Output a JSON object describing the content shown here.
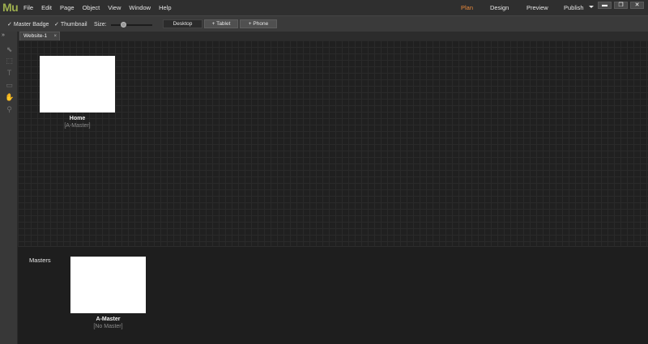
{
  "app": {
    "logo": "Mu"
  },
  "menu": [
    "File",
    "Edit",
    "Page",
    "Object",
    "View",
    "Window",
    "Help"
  ],
  "modes": {
    "plan": "Plan",
    "design": "Design",
    "preview": "Preview",
    "publish": "Publish"
  },
  "toolbar": {
    "master_badge": "Master Badge",
    "thumbnail": "Thumbnail",
    "size_label": "Size:",
    "layouts": [
      "Desktop",
      "+ Tablet",
      "+ Phone"
    ],
    "size_level": 0.3
  },
  "document_tab": {
    "title": "Website-1",
    "close": "×"
  },
  "pages": [
    {
      "name": "Home",
      "master": "[A-Master]"
    }
  ],
  "masters": {
    "label": "Masters",
    "items": [
      {
        "name": "A-Master",
        "master": "[No Master]"
      }
    ]
  },
  "colors": {
    "accent": "#e8893b",
    "logo": "#9dae4f",
    "background": "#202020"
  }
}
